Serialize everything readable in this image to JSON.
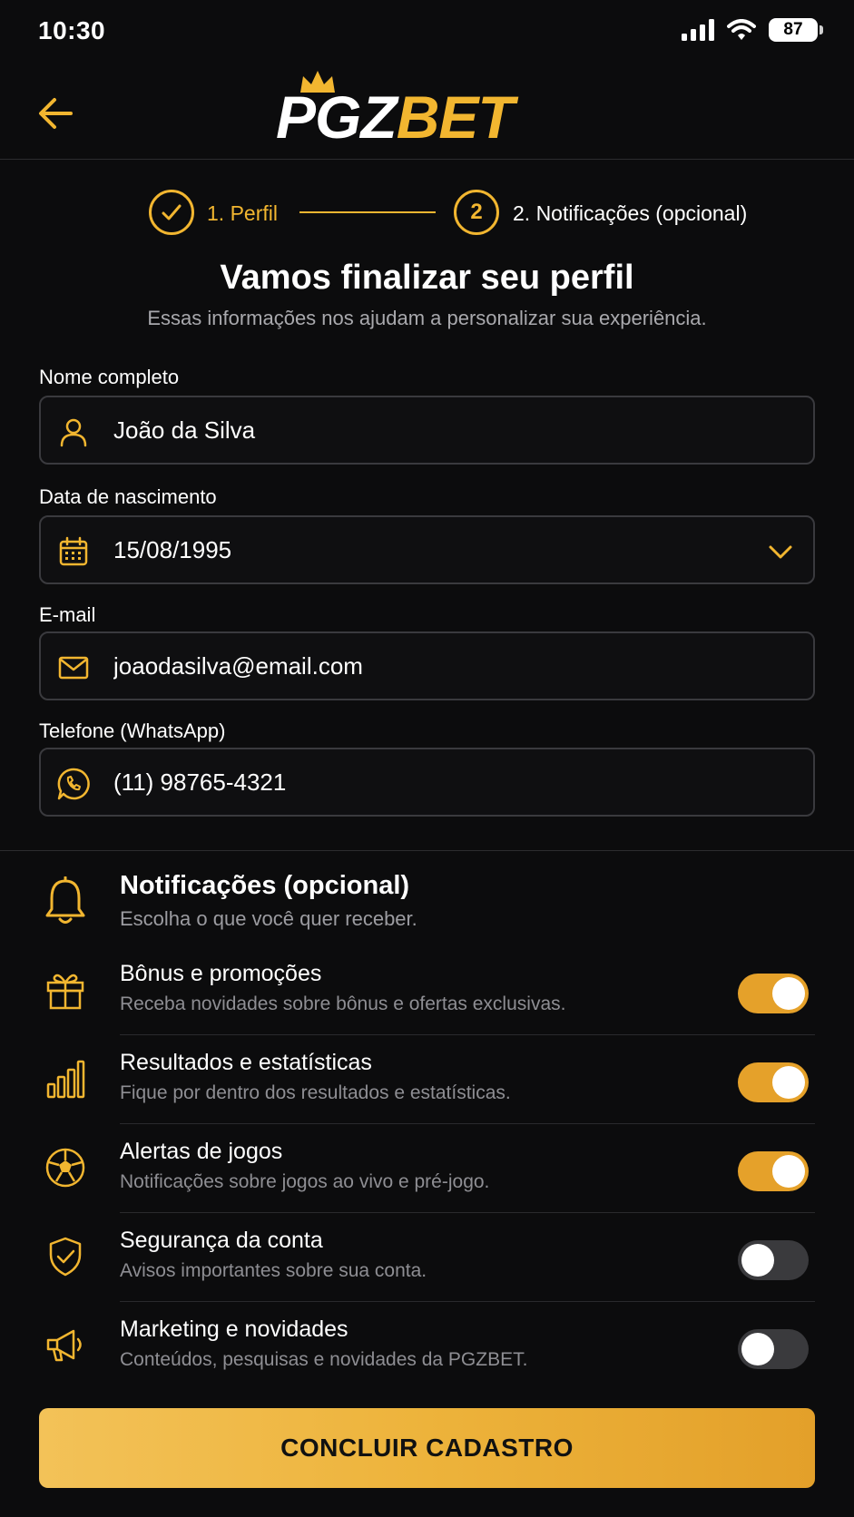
{
  "status": {
    "time": "10:30",
    "battery": "87"
  },
  "brand": {
    "logo_white": "PGZ",
    "logo_gold": "BET",
    "accent": "#f2b630"
  },
  "stepper": {
    "step1_number": "",
    "step1_label": "1. Perfil",
    "step2_number": "2",
    "step2_label": "2. Notificações (opcional)"
  },
  "page": {
    "title": "Vamos finalizar seu perfil",
    "subtitle": "Essas informações nos ajudam a personalizar sua experiência."
  },
  "form": {
    "name": {
      "label": "Nome completo",
      "value": "João da Silva",
      "icon": "user-icon"
    },
    "birth": {
      "label": "Data de nascimento",
      "value": "15/08/1995",
      "icon": "calendar-icon"
    },
    "email": {
      "label": "E-mail",
      "value": "joaodasilva@email.com",
      "icon": "mail-icon"
    },
    "phone": {
      "label": "Telefone (WhatsApp)",
      "value": "(11) 98765-4321",
      "icon": "whatsapp-icon"
    }
  },
  "notifications": {
    "title": "Notificações (opcional)",
    "subtitle": "Escolha o que você quer receber.",
    "items": [
      {
        "title": "Bônus e promoções",
        "desc": "Receba novidades sobre bônus e ofertas exclusivas.",
        "enabled": true,
        "icon": "gift-icon"
      },
      {
        "title": "Resultados e estatísticas",
        "desc": "Fique por dentro dos resultados e estatísticas.",
        "enabled": true,
        "icon": "bar-chart-icon"
      },
      {
        "title": "Alertas de jogos",
        "desc": "Notificações sobre jogos ao vivo e pré-jogo.",
        "enabled": true,
        "icon": "soccer-ball-icon"
      },
      {
        "title": "Segurança da conta",
        "desc": "Avisos importantes sobre sua conta.",
        "enabled": false,
        "icon": "shield-icon"
      },
      {
        "title": "Marketing e novidades",
        "desc": "Conteúdos, pesquisas e novidades da PGZBET.",
        "enabled": false,
        "icon": "megaphone-icon"
      }
    ]
  },
  "cta": {
    "label": "CONCLUIR CADASTRO"
  }
}
